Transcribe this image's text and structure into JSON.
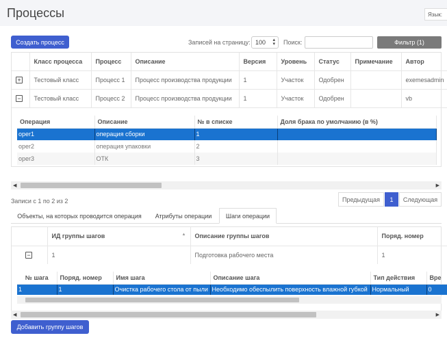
{
  "header": {
    "title": "Процессы",
    "language_label": "Язык:"
  },
  "toolbar": {
    "create_label": "Создать процесс",
    "per_page_label": "Записей на страницу:",
    "per_page_value": "100",
    "search_label": "Поиск:",
    "search_value": "",
    "filter_label": "Фильтр (1)"
  },
  "processes": {
    "columns": [
      "Класс процесса",
      "Процесс",
      "Описание",
      "Версия",
      "Уровень",
      "Статус",
      "Примечание",
      "Автор"
    ],
    "rows": [
      {
        "toggle": "+",
        "cells": [
          "Тестовый класс",
          "Процесс 1",
          "Процесс производства продукции",
          "1",
          "Участок",
          "Одобрен",
          "",
          "exemesadmin"
        ]
      },
      {
        "toggle": "−",
        "cells": [
          "Тестовый класс",
          "Процесс 2",
          "Процесс производства продукции",
          "1",
          "Участок",
          "Одобрен",
          "",
          "vb"
        ]
      }
    ]
  },
  "operations": {
    "columns": [
      "Операция",
      "Описание",
      "№ в списке",
      "Доля брака по умолчанию (в %)"
    ],
    "rows": [
      {
        "cells": [
          "oper1",
          "операция сборки",
          "1",
          ""
        ],
        "selected": true
      },
      {
        "cells": [
          "oper2",
          "операция упаковки",
          "2",
          ""
        ],
        "selected": false
      },
      {
        "cells": [
          "oper3",
          "ОТК",
          "3",
          ""
        ],
        "selected": false
      }
    ]
  },
  "pagination": {
    "info": "Записи с 1 по 2 из 2",
    "prev": "Предыдущая",
    "page": "1",
    "next": "Следующая"
  },
  "tabs": [
    {
      "label": "Объекты, на которых проводится операция",
      "active": false
    },
    {
      "label": "Атрибуты операции",
      "active": false
    },
    {
      "label": "Шаги операции",
      "active": true
    }
  ],
  "step_groups": {
    "columns": [
      "ИД группы шагов",
      "Описание группы шагов",
      "Поряд. номер"
    ],
    "rows": [
      {
        "toggle": "−",
        "cells": [
          "1",
          "Подготовка рабочего места",
          "1"
        ]
      }
    ]
  },
  "steps": {
    "columns": [
      "№ шага",
      "Поряд. номер",
      "Имя шага",
      "Описание шага",
      "Тип действия",
      "Вре"
    ],
    "rows": [
      {
        "cells": [
          "1",
          "1",
          "Очистка рабочего стола от пыли",
          "Необходимо обеспылить поверхность влажной губкой",
          "Нормальный",
          "0"
        ],
        "selected": true
      }
    ]
  },
  "footer": {
    "add_group_label": "Добавить группу шагов"
  },
  "colors": {
    "accent": "#3f5fcf",
    "selection": "#1a73d0",
    "filter": "#7a7a7a"
  }
}
